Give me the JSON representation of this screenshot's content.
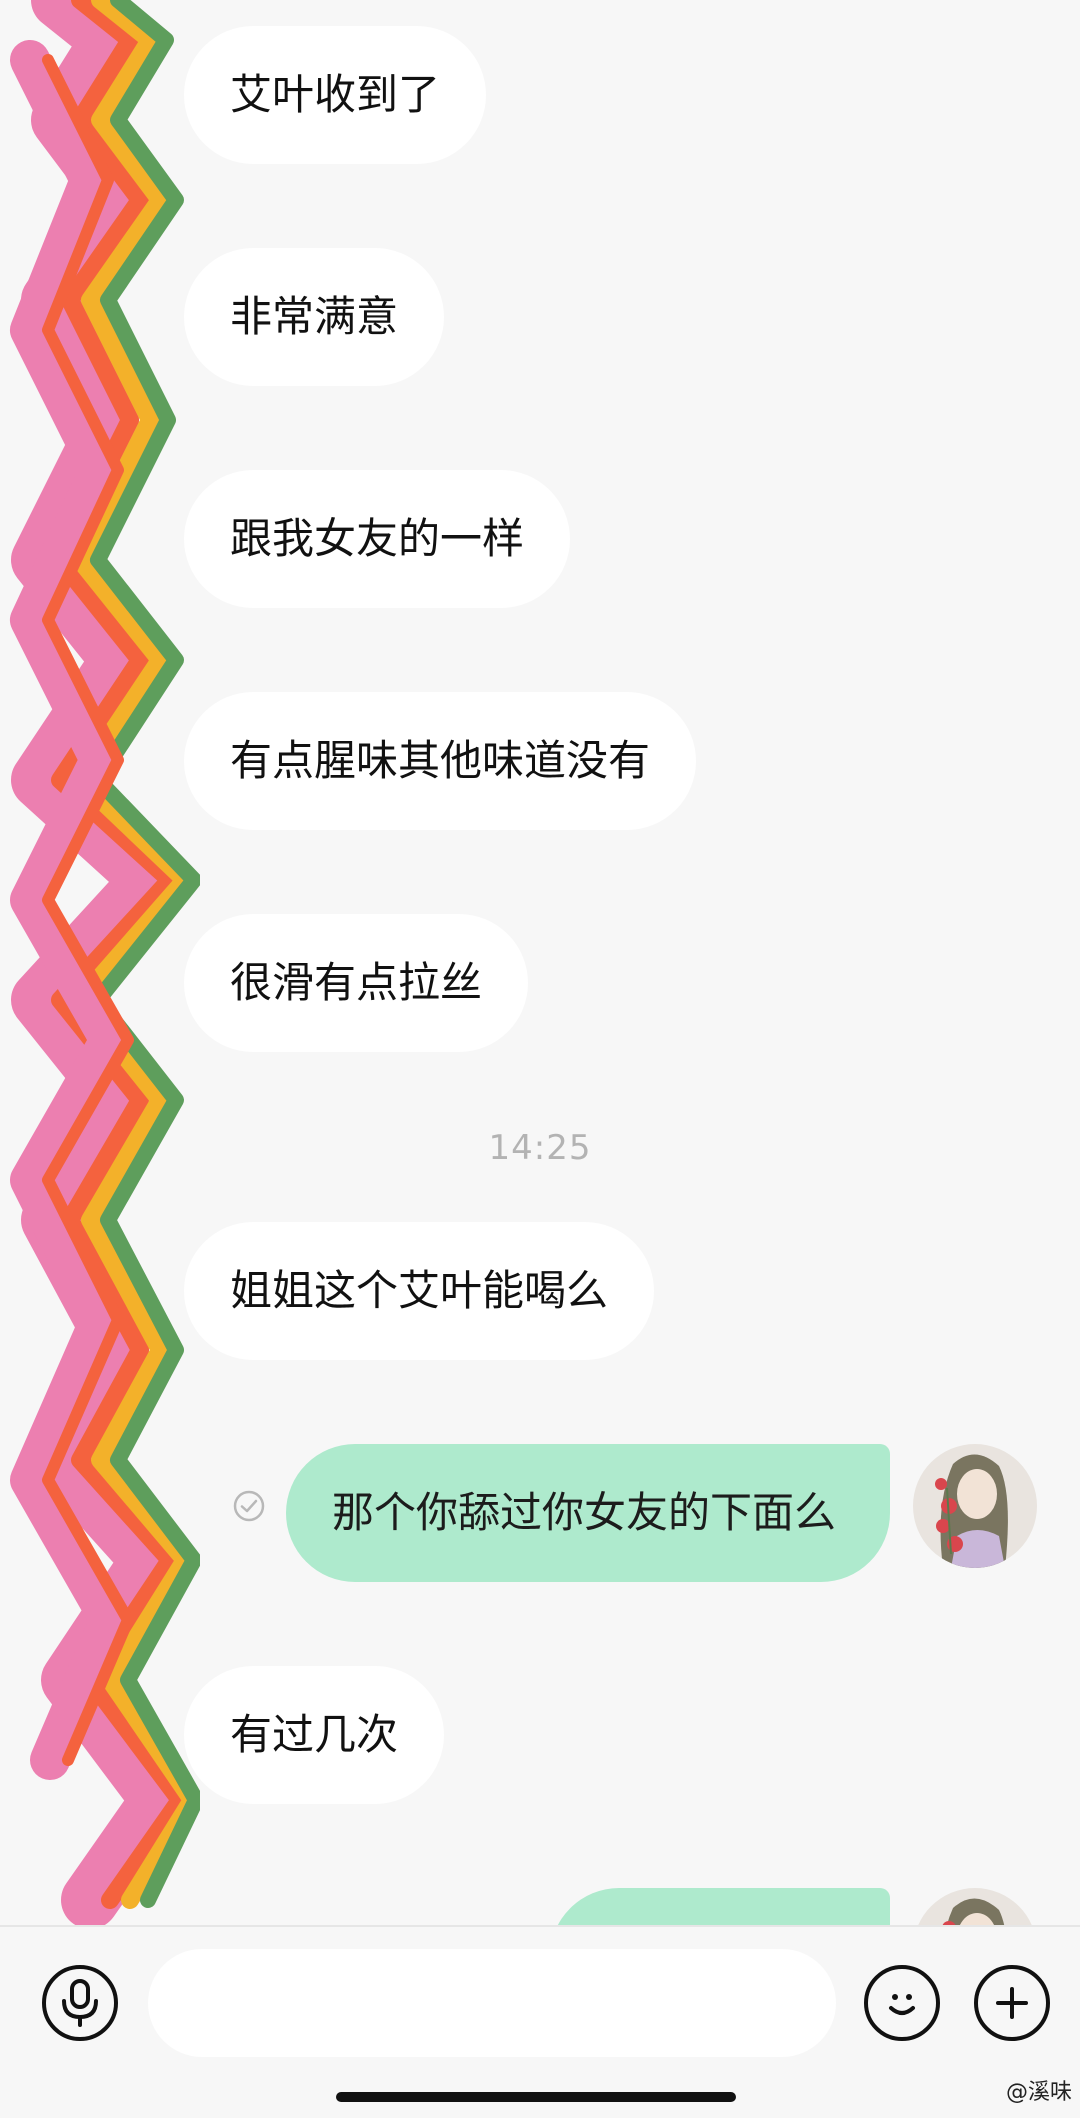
{
  "messages": [
    {
      "text": "艾叶收到了"
    },
    {
      "text": "非常满意"
    },
    {
      "text": "跟我女友的一样"
    },
    {
      "text": "有点腥味其他味道没有"
    },
    {
      "text": "很滑有点拉丝"
    },
    {
      "text": "姐姐这个艾叶能喝么"
    },
    {
      "text": "那个你舔过你女友的下面么"
    },
    {
      "text": "有过几次"
    }
  ],
  "timestamp": "14:25",
  "input": {
    "placeholder": ""
  },
  "icons": {
    "voice": "microphone-icon",
    "emoji": "smiley-icon",
    "plus": "plus-icon",
    "sent_status": "check-circle-icon"
  },
  "colors": {
    "outgoing_bubble": "#aeeacd",
    "incoming_bubble": "#ffffff",
    "background": "#f7f7f7"
  },
  "watermark": "@溪味"
}
